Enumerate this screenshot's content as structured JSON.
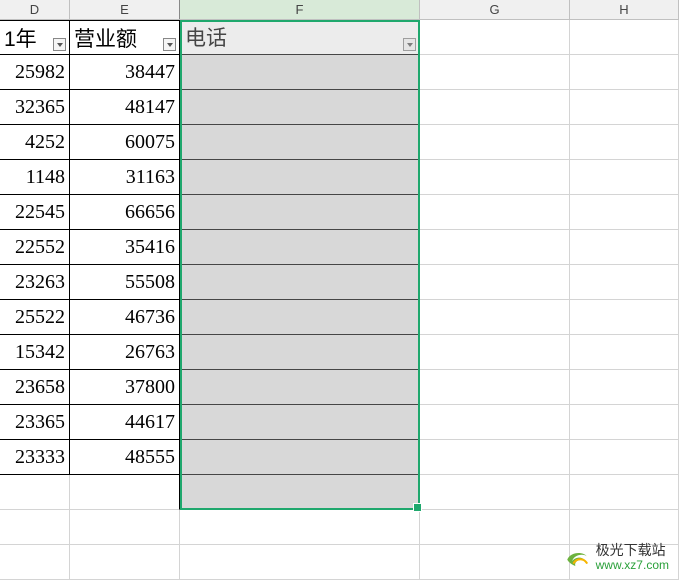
{
  "columns": {
    "d": "D",
    "e": "E",
    "f": "F",
    "g": "G",
    "h": "H"
  },
  "headers": {
    "d": "1年",
    "e": "营业额",
    "f": "电话"
  },
  "rows": [
    {
      "d": "25982",
      "e": "38447"
    },
    {
      "d": "32365",
      "e": "48147"
    },
    {
      "d": "4252",
      "e": "60075"
    },
    {
      "d": "1148",
      "e": "31163"
    },
    {
      "d": "22545",
      "e": "66656"
    },
    {
      "d": "22552",
      "e": "35416"
    },
    {
      "d": "23263",
      "e": "55508"
    },
    {
      "d": "25522",
      "e": "46736"
    },
    {
      "d": "15342",
      "e": "26763"
    },
    {
      "d": "23658",
      "e": "37800"
    },
    {
      "d": "23365",
      "e": "44617"
    },
    {
      "d": "23333",
      "e": "48555"
    }
  ],
  "watermark": {
    "site_name": "极光下载站",
    "url": "www.xz7.com"
  }
}
